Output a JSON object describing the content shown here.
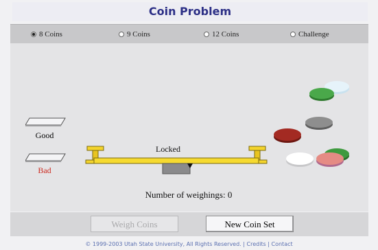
{
  "title": "Coin Problem",
  "tabs": [
    {
      "label": "8 Coins",
      "selected": true
    },
    {
      "label": "9 Coins",
      "selected": false
    },
    {
      "label": "12 Coins",
      "selected": false
    },
    {
      "label": "Challenge",
      "selected": false
    }
  ],
  "shelves": {
    "good_label": "Good",
    "bad_label": "Bad"
  },
  "scale": {
    "status": "Locked"
  },
  "weighings": {
    "text": "Number of weighings: 0",
    "count": 0
  },
  "coins": [
    {
      "color": "#e6f3fa",
      "name": "light-blue"
    },
    {
      "color": "#4aa84a",
      "name": "green"
    },
    {
      "color": "#8e8e8e",
      "name": "gray"
    },
    {
      "color": "#a32a22",
      "name": "dark-red"
    },
    {
      "color": "#3e9a3e",
      "name": "green-2"
    },
    {
      "color": "#ffffff",
      "name": "white"
    },
    {
      "color": "#e58b84",
      "name": "pink"
    }
  ],
  "buttons": {
    "weigh": "Weigh Coins",
    "new_set": "New Coin Set"
  },
  "footer": "© 1999-2003 Utah State University, All Rights Reserved. | Credits | Contact",
  "colors": {
    "title": "#2c2f86",
    "bad_label": "#cc2a20",
    "scale": "#f0d12a",
    "footer": "#5a6fb0"
  }
}
